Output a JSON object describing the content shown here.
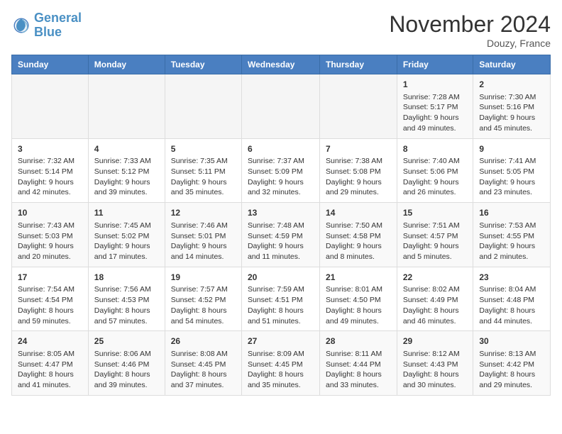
{
  "logo": {
    "line1": "General",
    "line2": "Blue"
  },
  "title": "November 2024",
  "location": "Douzy, France",
  "days_of_week": [
    "Sunday",
    "Monday",
    "Tuesday",
    "Wednesday",
    "Thursday",
    "Friday",
    "Saturday"
  ],
  "weeks": [
    [
      {
        "day": "",
        "content": ""
      },
      {
        "day": "",
        "content": ""
      },
      {
        "day": "",
        "content": ""
      },
      {
        "day": "",
        "content": ""
      },
      {
        "day": "",
        "content": ""
      },
      {
        "day": "1",
        "content": "Sunrise: 7:28 AM\nSunset: 5:17 PM\nDaylight: 9 hours and 49 minutes."
      },
      {
        "day": "2",
        "content": "Sunrise: 7:30 AM\nSunset: 5:16 PM\nDaylight: 9 hours and 45 minutes."
      }
    ],
    [
      {
        "day": "3",
        "content": "Sunrise: 7:32 AM\nSunset: 5:14 PM\nDaylight: 9 hours and 42 minutes."
      },
      {
        "day": "4",
        "content": "Sunrise: 7:33 AM\nSunset: 5:12 PM\nDaylight: 9 hours and 39 minutes."
      },
      {
        "day": "5",
        "content": "Sunrise: 7:35 AM\nSunset: 5:11 PM\nDaylight: 9 hours and 35 minutes."
      },
      {
        "day": "6",
        "content": "Sunrise: 7:37 AM\nSunset: 5:09 PM\nDaylight: 9 hours and 32 minutes."
      },
      {
        "day": "7",
        "content": "Sunrise: 7:38 AM\nSunset: 5:08 PM\nDaylight: 9 hours and 29 minutes."
      },
      {
        "day": "8",
        "content": "Sunrise: 7:40 AM\nSunset: 5:06 PM\nDaylight: 9 hours and 26 minutes."
      },
      {
        "day": "9",
        "content": "Sunrise: 7:41 AM\nSunset: 5:05 PM\nDaylight: 9 hours and 23 minutes."
      }
    ],
    [
      {
        "day": "10",
        "content": "Sunrise: 7:43 AM\nSunset: 5:03 PM\nDaylight: 9 hours and 20 minutes."
      },
      {
        "day": "11",
        "content": "Sunrise: 7:45 AM\nSunset: 5:02 PM\nDaylight: 9 hours and 17 minutes."
      },
      {
        "day": "12",
        "content": "Sunrise: 7:46 AM\nSunset: 5:01 PM\nDaylight: 9 hours and 14 minutes."
      },
      {
        "day": "13",
        "content": "Sunrise: 7:48 AM\nSunset: 4:59 PM\nDaylight: 9 hours and 11 minutes."
      },
      {
        "day": "14",
        "content": "Sunrise: 7:50 AM\nSunset: 4:58 PM\nDaylight: 9 hours and 8 minutes."
      },
      {
        "day": "15",
        "content": "Sunrise: 7:51 AM\nSunset: 4:57 PM\nDaylight: 9 hours and 5 minutes."
      },
      {
        "day": "16",
        "content": "Sunrise: 7:53 AM\nSunset: 4:55 PM\nDaylight: 9 hours and 2 minutes."
      }
    ],
    [
      {
        "day": "17",
        "content": "Sunrise: 7:54 AM\nSunset: 4:54 PM\nDaylight: 8 hours and 59 minutes."
      },
      {
        "day": "18",
        "content": "Sunrise: 7:56 AM\nSunset: 4:53 PM\nDaylight: 8 hours and 57 minutes."
      },
      {
        "day": "19",
        "content": "Sunrise: 7:57 AM\nSunset: 4:52 PM\nDaylight: 8 hours and 54 minutes."
      },
      {
        "day": "20",
        "content": "Sunrise: 7:59 AM\nSunset: 4:51 PM\nDaylight: 8 hours and 51 minutes."
      },
      {
        "day": "21",
        "content": "Sunrise: 8:01 AM\nSunset: 4:50 PM\nDaylight: 8 hours and 49 minutes."
      },
      {
        "day": "22",
        "content": "Sunrise: 8:02 AM\nSunset: 4:49 PM\nDaylight: 8 hours and 46 minutes."
      },
      {
        "day": "23",
        "content": "Sunrise: 8:04 AM\nSunset: 4:48 PM\nDaylight: 8 hours and 44 minutes."
      }
    ],
    [
      {
        "day": "24",
        "content": "Sunrise: 8:05 AM\nSunset: 4:47 PM\nDaylight: 8 hours and 41 minutes."
      },
      {
        "day": "25",
        "content": "Sunrise: 8:06 AM\nSunset: 4:46 PM\nDaylight: 8 hours and 39 minutes."
      },
      {
        "day": "26",
        "content": "Sunrise: 8:08 AM\nSunset: 4:45 PM\nDaylight: 8 hours and 37 minutes."
      },
      {
        "day": "27",
        "content": "Sunrise: 8:09 AM\nSunset: 4:45 PM\nDaylight: 8 hours and 35 minutes."
      },
      {
        "day": "28",
        "content": "Sunrise: 8:11 AM\nSunset: 4:44 PM\nDaylight: 8 hours and 33 minutes."
      },
      {
        "day": "29",
        "content": "Sunrise: 8:12 AM\nSunset: 4:43 PM\nDaylight: 8 hours and 30 minutes."
      },
      {
        "day": "30",
        "content": "Sunrise: 8:13 AM\nSunset: 4:42 PM\nDaylight: 8 hours and 29 minutes."
      }
    ]
  ]
}
